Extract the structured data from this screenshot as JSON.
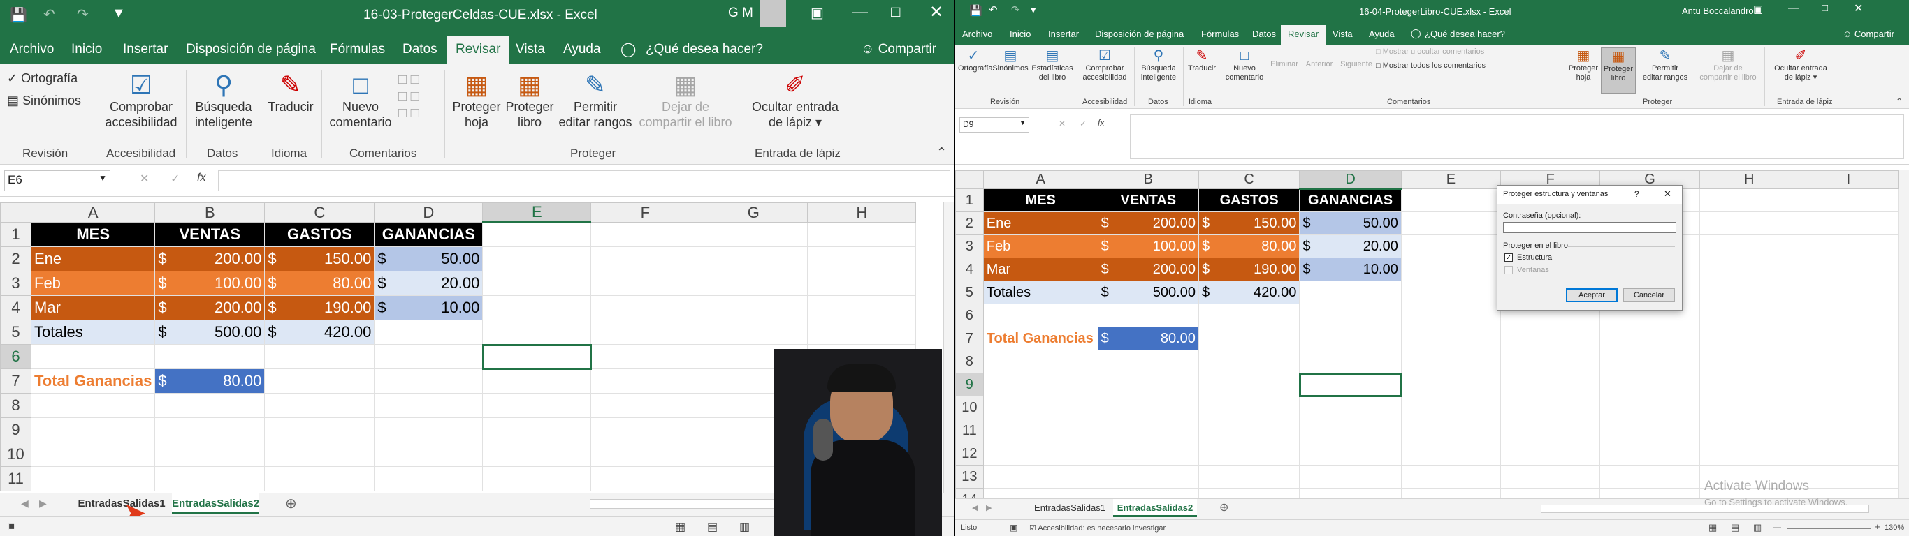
{
  "left": {
    "title": "16-03-ProtegerCeldas-CUE.xlsx  -  Excel",
    "user": "G M",
    "tabs": [
      "Archivo",
      "Inicio",
      "Insertar",
      "Disposición de página",
      "Fórmulas",
      "Datos",
      "Revisar",
      "Vista",
      "Ayuda"
    ],
    "tell_me": "¿Qué desea hacer?",
    "share": "Compartir",
    "ribbon": {
      "spelling": "Ortografía",
      "synonyms": "Sinónimos",
      "check_access": "Comprobar\naccesibilidad",
      "smart_lookup": "Búsqueda\ninteligente",
      "translate": "Traducir",
      "new_comment": "Nuevo\ncomentario",
      "protect_sheet": "Proteger\nhoja",
      "protect_book": "Proteger\nlibro",
      "allow_edit": "Permitir\neditar rangos",
      "unshare": "Dejar de\ncompartir el libro",
      "hide_ink": "Ocultar entrada\nde lápiz",
      "groups": [
        "Revisión",
        "Accesibilidad",
        "Datos",
        "Idioma",
        "Comentarios",
        "Proteger",
        "Entrada de lápiz"
      ]
    },
    "namebox": "E6",
    "fx": "fx",
    "columns": [
      "A",
      "B",
      "C",
      "D",
      "E",
      "F",
      "G",
      "H"
    ],
    "rows": [
      "1",
      "2",
      "3",
      "4",
      "5",
      "6",
      "7",
      "8",
      "9",
      "10",
      "11"
    ],
    "header": [
      "MES",
      "VENTAS",
      "GASTOS",
      "GANANCIAS"
    ],
    "data": [
      [
        "Ene",
        "200.00",
        "150.00",
        "50.00"
      ],
      [
        "Feb",
        "100.00",
        "80.00",
        "20.00"
      ],
      [
        "Mar",
        "200.00",
        "190.00",
        "10.00"
      ]
    ],
    "totals": [
      "Totales",
      "500.00",
      "420.00"
    ],
    "total_label": "Total Ganancias",
    "total_value": "80.00",
    "currency": "$",
    "sheets": [
      "EntradasSalidas1",
      "EntradasSalidas2"
    ]
  },
  "right": {
    "title": "16-04-ProtegerLibro-CUE.xlsx  -  Excel",
    "user": "Antu Boccalandro",
    "tabs": [
      "Archivo",
      "Inicio",
      "Insertar",
      "Disposición de página",
      "Fórmulas",
      "Datos",
      "Revisar",
      "Vista",
      "Ayuda"
    ],
    "tell_me": "¿Qué desea hacer?",
    "share": "Compartir",
    "ribbon": {
      "spelling": "Ortografía",
      "synonyms": "Sinónimos",
      "stats": "Estadísticas\ndel libro",
      "check_access": "Comprobar\naccesibilidad",
      "smart_lookup": "Búsqueda\ninteligente",
      "translate": "Traducir",
      "new_comment": "Nuevo\ncomentario",
      "delete": "Eliminar",
      "prev": "Anterior",
      "next": "Siguiente",
      "show_hide": "Mostrar u ocultar comentarios",
      "show_all": "Mostrar todos los comentarios",
      "protect_sheet": "Proteger\nhoja",
      "protect_book": "Proteger\nlibro",
      "allow_edit": "Permitir\neditar rangos",
      "unshare": "Dejar de\ncompartir el libro",
      "hide_ink": "Ocultar entrada\nde lápiz",
      "groups": [
        "Revisión",
        "Accesibilidad",
        "Datos",
        "Idioma",
        "Comentarios",
        "Proteger",
        "Entrada de lápiz"
      ]
    },
    "namebox": "D9",
    "fx": "fx",
    "columns": [
      "A",
      "B",
      "C",
      "D",
      "E",
      "F",
      "G",
      "H",
      "I"
    ],
    "rows": [
      "1",
      "2",
      "3",
      "4",
      "5",
      "6",
      "7",
      "8",
      "9",
      "10",
      "11",
      "12",
      "13",
      "14"
    ],
    "sheets": [
      "EntradasSalidas1",
      "EntradasSalidas2"
    ],
    "status_ready": "Listo",
    "status_access": "Accesibilidad: es necesario investigar",
    "zoom": "130%",
    "activate": "Activate Windows",
    "activate_sub": "Go to Settings to activate Windows.",
    "dialog": {
      "title": "Proteger estructura y ventanas",
      "help": "?",
      "password_label": "Contraseña (opcional):",
      "protect_in": "Proteger en el libro",
      "structure": "Estructura",
      "windows": "Ventanas",
      "ok": "Aceptar",
      "cancel": "Cancelar"
    }
  }
}
